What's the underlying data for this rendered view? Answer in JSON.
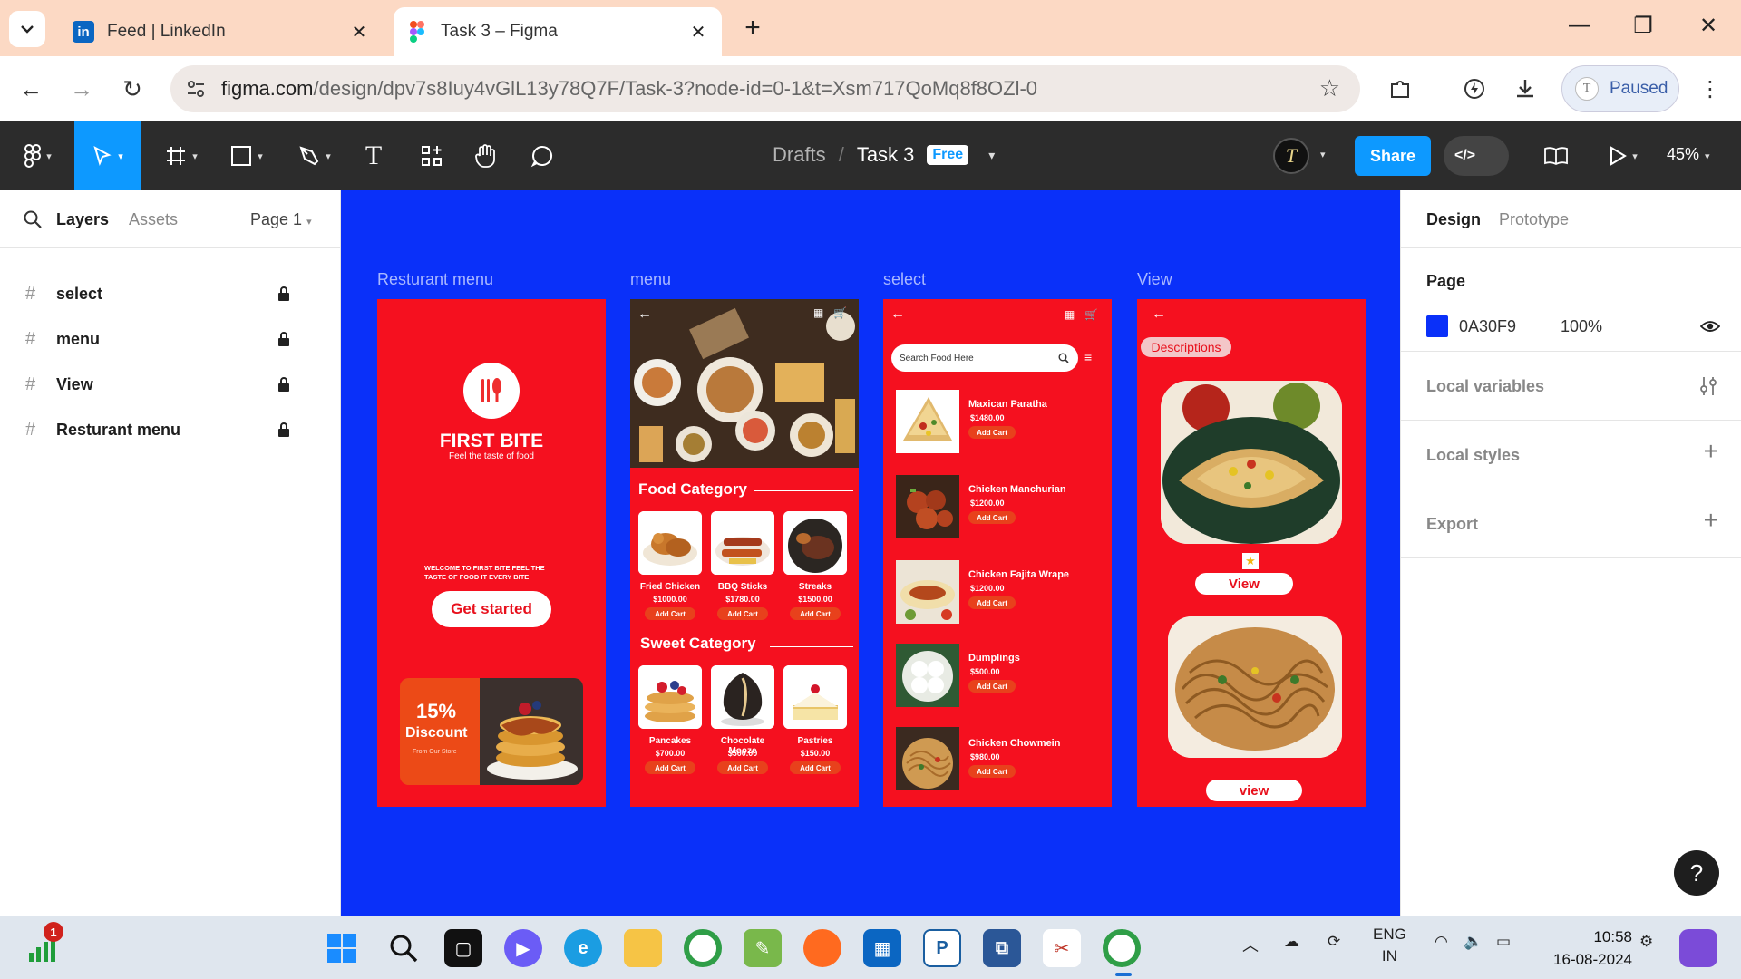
{
  "browser": {
    "tabs": [
      {
        "title": "Feed | LinkedIn",
        "icon": "linkedin-icon",
        "active": false
      },
      {
        "title": "Task 3 – Figma",
        "icon": "figma-icon",
        "active": true
      }
    ],
    "url_host": "figma.com",
    "url_path": "/design/dpv7s8Iuy4vGlL13y78Q7F/Task-3?node-id=0-1&t=Xsm717QoMq8f8OZl-0",
    "profile_initial": "T",
    "profile_status": "Paused"
  },
  "figma": {
    "breadcrumb": {
      "folder": "Drafts",
      "file": "Task 3",
      "plan_badge": "Free"
    },
    "share_label": "Share",
    "zoom": "45%",
    "left_panel": {
      "tab_layers": "Layers",
      "tab_assets": "Assets",
      "page_selector": "Page 1",
      "layers": [
        "select",
        "menu",
        "View",
        "Resturant menu"
      ]
    },
    "right_panel": {
      "tab_design": "Design",
      "tab_prototype": "Prototype",
      "page_heading": "Page",
      "page_color_hex": "0A30F9",
      "page_opacity": "100%",
      "sections": [
        "Local variables",
        "Local styles",
        "Export"
      ]
    },
    "canvas_color": "#0A30F9",
    "help_label": "?"
  },
  "frames": {
    "resturant": {
      "label": "Resturant menu",
      "brand_title": "FIRST BITE",
      "brand_tagline": "Feel the taste of food",
      "welcome": "WELCOME TO FIRST BITE FEEL THE TASTE OF FOOD IT EVERY BITE",
      "cta": "Get started",
      "discount_big": "15%",
      "discount_word": "Discount",
      "discount_sub": "From Our Store"
    },
    "menu": {
      "label": "menu",
      "food_category_title": "Food Category",
      "sweet_category_title": "Sweet Category",
      "food_items": [
        {
          "name": "Fried Chicken",
          "price": "$1000.00",
          "btn": "Add Cart"
        },
        {
          "name": "BBQ Sticks",
          "price": "$1780.00",
          "btn": "Add Cart"
        },
        {
          "name": "Streaks",
          "price": "$1500.00",
          "btn": "Add Cart"
        }
      ],
      "sweet_items": [
        {
          "name": "Pancakes",
          "price": "$700.00",
          "btn": "Add Cart"
        },
        {
          "name": "Chocolate Mooze",
          "price": "$500.00",
          "btn": "Add Cart"
        },
        {
          "name": "Pastries",
          "price": "$150.00",
          "btn": "Add Cart"
        }
      ]
    },
    "select": {
      "label": "select",
      "search_placeholder": "Search Food Here",
      "items": [
        {
          "name": "Maxican Paratha",
          "price": "$1480.00",
          "btn": "Add Cart"
        },
        {
          "name": "Chicken Manchurian",
          "price": "$1200.00",
          "btn": "Add Cart"
        },
        {
          "name": "Chicken Fajita Wrape",
          "price": "$1200.00",
          "btn": "Add Cart"
        },
        {
          "name": "Dumplings",
          "price": "$500.00",
          "btn": "Add Cart"
        },
        {
          "name": "Chicken Chowmein",
          "price": "$980.00",
          "btn": "Add Cart"
        }
      ]
    },
    "view": {
      "label": "View",
      "descriptions": "Descriptions",
      "view_btn_1": "View",
      "view_btn_2": "view"
    }
  },
  "taskbar": {
    "notification_count": "1",
    "language_line1": "ENG",
    "language_line2": "IN",
    "time": "10:58",
    "date": "16-08-2024"
  }
}
